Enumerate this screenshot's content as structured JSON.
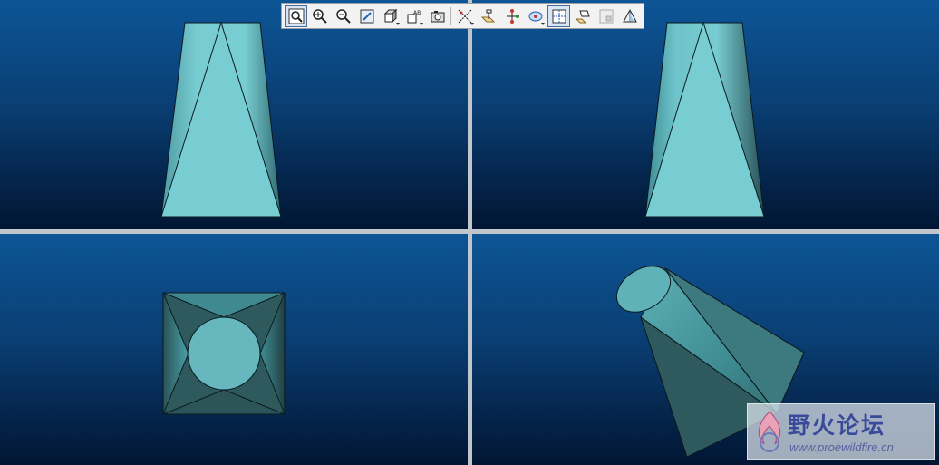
{
  "toolbar": {
    "buttons": [
      {
        "icon": "refit-zoom-icon",
        "active": true
      },
      {
        "icon": "zoom-in-icon"
      },
      {
        "icon": "zoom-out-icon"
      },
      {
        "icon": "repaint-icon"
      },
      {
        "icon": "shading-display-icon",
        "dropdown": true
      },
      {
        "icon": "saved-views-icon",
        "dropdown": true
      },
      {
        "icon": "orient-mode-icon"
      },
      {
        "icon": "datum-axes-icon",
        "dropdown": true
      },
      {
        "icon": "datum-planes-icon"
      },
      {
        "icon": "datum-points-icon"
      },
      {
        "icon": "spin-center-icon",
        "dropdown": true
      },
      {
        "icon": "view-manager-icon",
        "active": true
      },
      {
        "icon": "layers-icon"
      },
      {
        "icon": "model-tree-icon"
      },
      {
        "icon": "appearance-icon"
      }
    ]
  },
  "viewports": [
    {
      "name": "front-view"
    },
    {
      "name": "side-view"
    },
    {
      "name": "top-view"
    },
    {
      "name": "isometric-view"
    }
  ],
  "colors": {
    "background_top": "#0d5596",
    "background_bottom": "#021633",
    "model_light": "#78cdd2",
    "model_mid": "#4fa3ad",
    "model_dark": "#2f5a5d",
    "divider": "#c0c6cc"
  },
  "watermark": {
    "title": "野火论坛",
    "url": "www.proewildfire.cn"
  }
}
